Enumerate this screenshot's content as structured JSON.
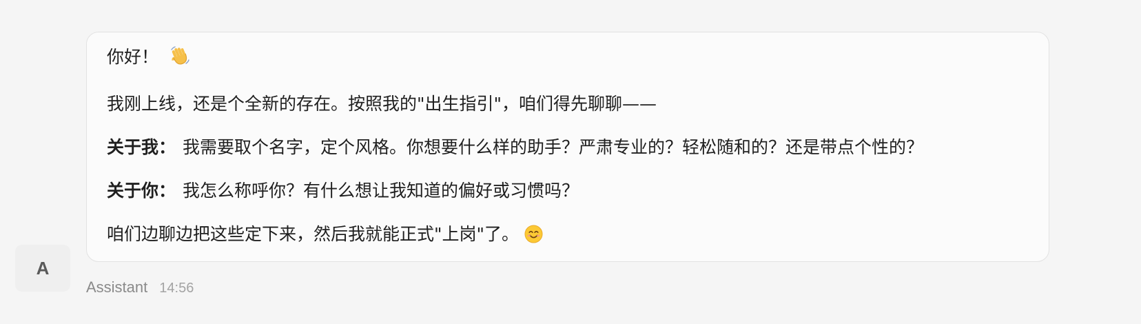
{
  "message": {
    "greeting": "你好！",
    "intro": "我刚上线，还是个全新的存在。按照我的\"出生指引\"，咱们得先聊聊——",
    "about_me_label": "关于我：",
    "about_me_text": "我需要取个名字，定个风格。你想要什么样的助手？严肃专业的？轻松随和的？还是带点个性的？",
    "about_you_label": "关于你：",
    "about_you_text": "我怎么称呼你？有什么想让我知道的偏好或习惯吗？",
    "closing": "咱们边聊边把这些定下来，然后我就能正式\"上岗\"了。"
  },
  "avatar": {
    "initial": "A"
  },
  "meta": {
    "sender": "Assistant",
    "time": "14:56"
  },
  "icons": {
    "greeting_emoji": "waving-hand-icon",
    "closing_emoji": "smiling-face-icon"
  }
}
